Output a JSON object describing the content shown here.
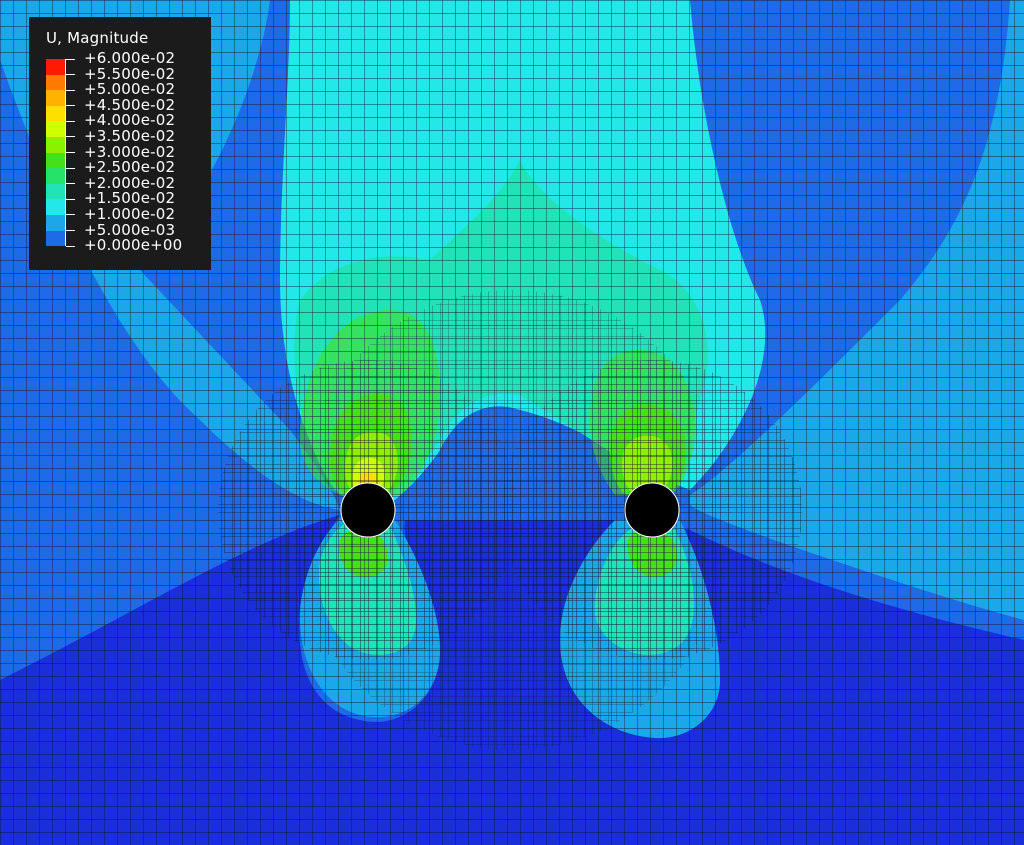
{
  "legend": {
    "title": "U, Magnitude",
    "levels": [
      {
        "label": "+6.000e-02",
        "color": "#ff1a00"
      },
      {
        "label": "+5.500e-02",
        "color": "#ff7a00"
      },
      {
        "label": "+5.000e-02",
        "color": "#ffb300"
      },
      {
        "label": "+4.500e-02",
        "color": "#ffdf00"
      },
      {
        "label": "+4.000e-02",
        "color": "#cfff00"
      },
      {
        "label": "+3.500e-02",
        "color": "#8df000"
      },
      {
        "label": "+3.000e-02",
        "color": "#46e01a"
      },
      {
        "label": "+2.500e-02",
        "color": "#24e36a"
      },
      {
        "label": "+2.000e-02",
        "color": "#22e3b7"
      },
      {
        "label": "+1.500e-02",
        "color": "#22e8ea"
      },
      {
        "label": "+1.000e-02",
        "color": "#1ba7e8"
      },
      {
        "label": "+5.000e-03",
        "color": "#1f6ae6"
      },
      {
        "label": "+0.000e+00",
        "color": "#1a2fd9"
      }
    ]
  },
  "holes": [
    {
      "name": "left-hole"
    },
    {
      "name": "right-hole"
    }
  ]
}
